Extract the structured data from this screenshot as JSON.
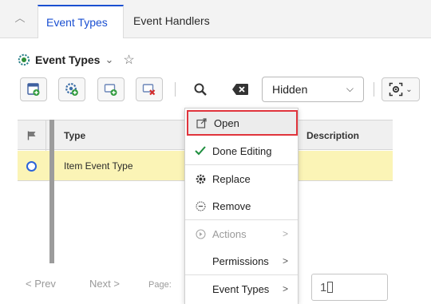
{
  "tabs": [
    {
      "label": "Event Types",
      "active": true
    },
    {
      "label": "Event Handlers",
      "active": false
    }
  ],
  "header": {
    "title": "Event Types",
    "title_icon": "event-types-gear-icon",
    "favorite_icon": "star-outline-icon"
  },
  "toolbar": {
    "buttons": [
      "new-form-icon",
      "new-gear-icon",
      "add-item-icon",
      "delete-item-icon",
      "search-icon",
      "clear-icon"
    ],
    "filter_select": {
      "value": "Hidden"
    },
    "view_button_icon": "view-settings-icon"
  },
  "grid": {
    "columns": [
      "Type",
      "Description"
    ],
    "rows": [
      {
        "type": "Item Event Type",
        "description": "",
        "selected": true
      }
    ],
    "selected_row_color": "#fbf4b6"
  },
  "pager": {
    "prev": "< Prev",
    "next": "Next >",
    "page_label": "Page:",
    "page_input_value": "1"
  },
  "context_menu": {
    "items": [
      {
        "label": "Open",
        "icon": "open-external-icon",
        "highlighted": true
      },
      {
        "label": "Done Editing",
        "icon": "checkmark-icon"
      },
      {
        "label": "Replace",
        "icon": "replace-gear-icon"
      },
      {
        "label": "Remove",
        "icon": "remove-circle-icon"
      },
      {
        "label": "Actions",
        "icon": "actions-circle-icon",
        "disabled": true,
        "submenu": true
      },
      {
        "label": "Permissions",
        "submenu": true
      },
      {
        "label": "Event Types",
        "submenu": true
      }
    ],
    "highlight_color": "#e0343c"
  },
  "colors": {
    "accent": "#1a4fd1",
    "check_green": "#1e8e3e",
    "delete_red": "#d22b2b"
  }
}
